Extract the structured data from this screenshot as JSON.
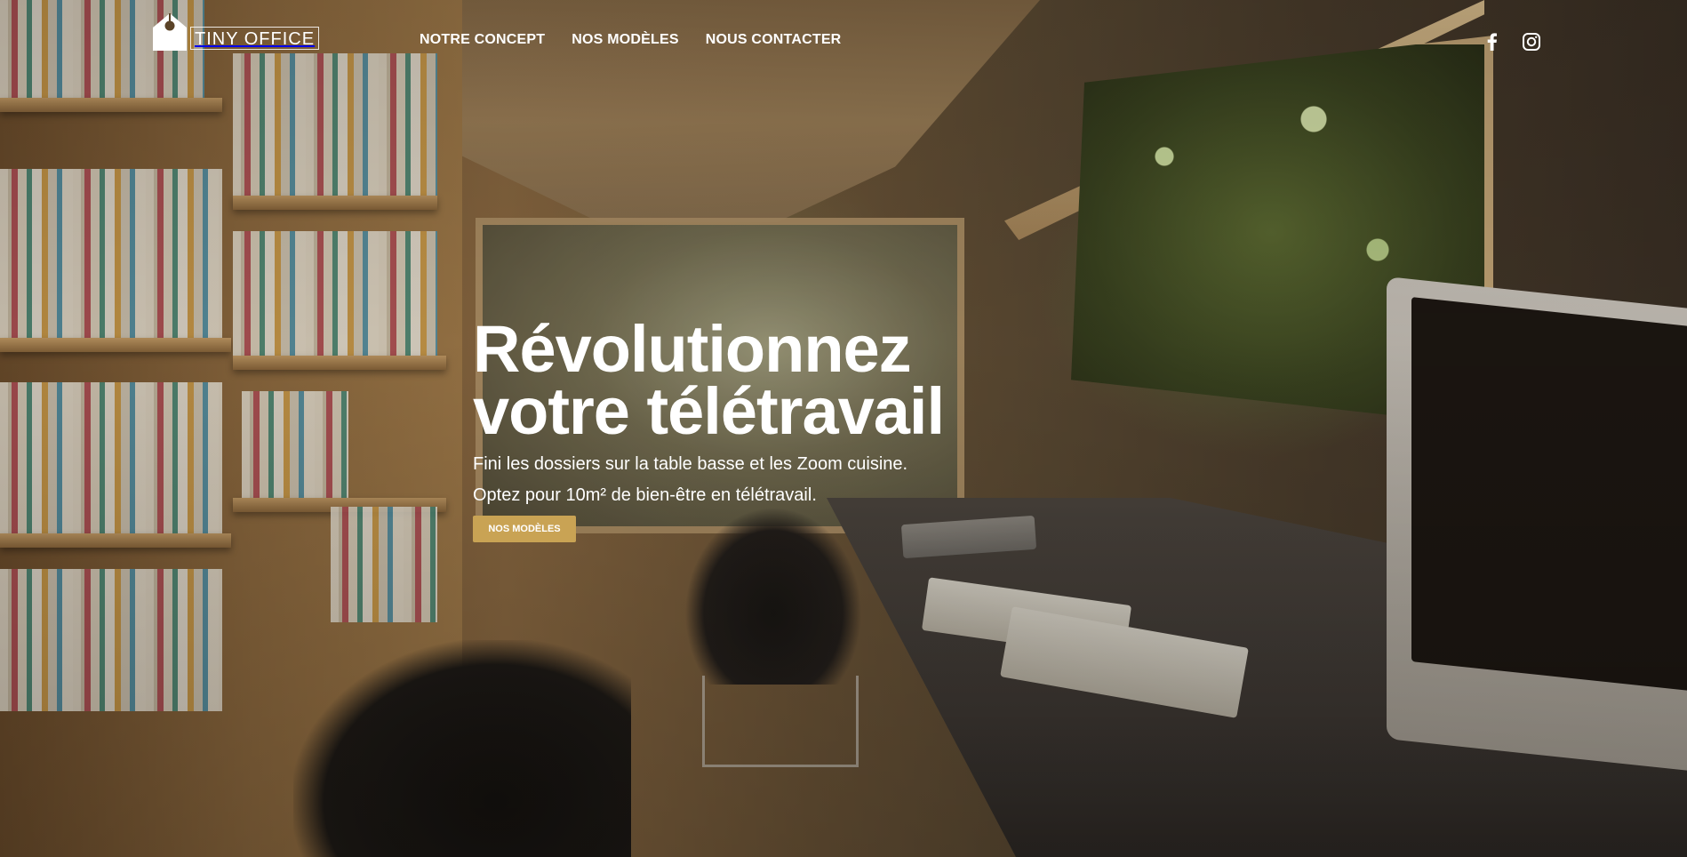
{
  "brand": {
    "name": "TINY OFFICE",
    "logo_icon": "house-icon"
  },
  "nav": {
    "items": [
      {
        "label": "NOTRE CONCEPT"
      },
      {
        "label": "NOS MODÈLES"
      },
      {
        "label": "NOUS CONTACTER"
      }
    ]
  },
  "social": {
    "facebook_icon": "facebook-icon",
    "instagram_icon": "instagram-icon"
  },
  "hero": {
    "title_line1": "Révolutionnez",
    "title_line2": "votre télétravail",
    "subtitle_line1": "Fini les dossiers sur la table basse et les Zoom cuisine.",
    "subtitle_line2": "Optez pour 10m² de bien-être en télétravail.",
    "cta_label": "NOS MODÈLES"
  },
  "colors": {
    "accent": "#c9a354",
    "text": "#ffffff"
  }
}
